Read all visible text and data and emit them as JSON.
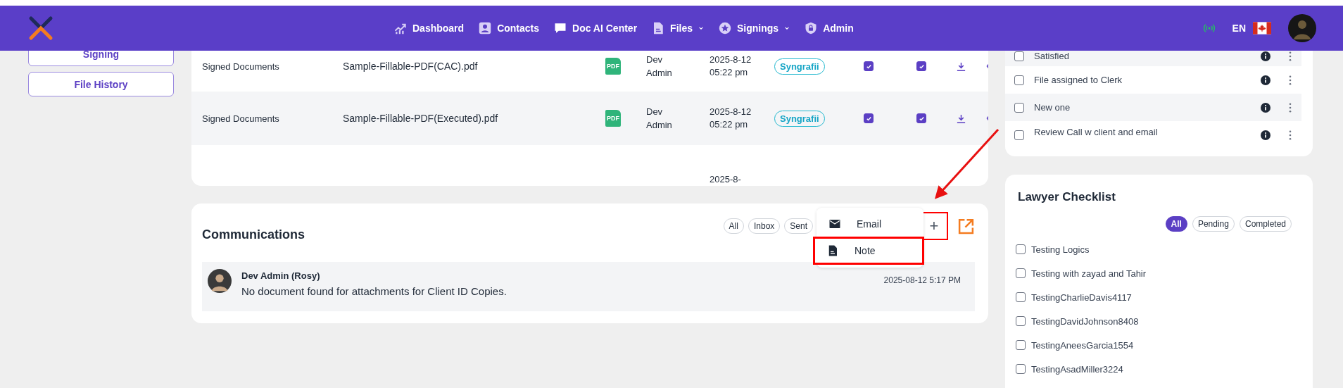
{
  "nav": {
    "menu": [
      {
        "label": "Dashboard",
        "dropdown": false
      },
      {
        "label": "Contacts",
        "dropdown": false
      },
      {
        "label": "Doc AI Center",
        "dropdown": false
      },
      {
        "label": "Files",
        "dropdown": true
      },
      {
        "label": "Signings",
        "dropdown": true
      },
      {
        "label": "Admin",
        "dropdown": false
      }
    ],
    "language": "EN"
  },
  "side_buttons": [
    "Signing",
    "File History"
  ],
  "documents": {
    "rows": [
      {
        "category": "Signed Documents",
        "file": "Sample-Fillable-PDF(CAC).pdf",
        "file_badge": "PDF",
        "uploaded_by": "Dev Admin",
        "date": "2025-8-12 05:22 pm",
        "platform": "Syngrafii",
        "check_1": true,
        "check_2": true
      },
      {
        "category": "Signed Documents",
        "file": "Sample-Fillable-PDF(Executed).pdf",
        "file_badge": "PDF",
        "uploaded_by": "Dev Admin",
        "date": "2025-8-12 05:22 pm",
        "platform": "Syngrafii",
        "check_1": true,
        "check_2": true
      },
      {
        "date": "2025-8-"
      }
    ]
  },
  "communications": {
    "title": "Communications",
    "filters": [
      {
        "label": "All",
        "selected": false
      },
      {
        "label": "Inbox",
        "selected": false
      },
      {
        "label": "Sent",
        "selected": false
      }
    ],
    "add_button": {
      "label": "+",
      "highlighted": true
    },
    "menu": [
      {
        "label": "Email",
        "highlighted": false
      },
      {
        "label": "Note",
        "highlighted": true
      }
    ],
    "callout_arrow": true,
    "messages": [
      {
        "author": "Dev Admin (Rosy)",
        "text": "No document found for attachments for Client ID Copies.",
        "time": "2025-08-12 5:17 PM"
      }
    ]
  },
  "tasks": {
    "items": [
      {
        "label": "Satisfied",
        "checked": false
      },
      {
        "label": "File assigned to Clerk",
        "checked": false
      },
      {
        "label": "New one",
        "checked": false
      },
      {
        "label": "Review Call w client and email",
        "checked": false
      }
    ]
  },
  "lawyer_checklist": {
    "title": "Lawyer Checklist",
    "filters": [
      {
        "label": "All",
        "selected": true
      },
      {
        "label": "Pending",
        "selected": false
      },
      {
        "label": "Completed",
        "selected": false
      }
    ],
    "items": [
      {
        "label": "Testing Logics",
        "checked": false
      },
      {
        "label": "Testing with zayad and Tahir",
        "checked": false
      },
      {
        "label": "TestingCharlieDavis4117",
        "checked": false
      },
      {
        "label": "TestingDavidJohnson8408",
        "checked": false
      },
      {
        "label": "TestingAneesGarcia1554",
        "checked": false
      },
      {
        "label": "TestingAsadMiller3224",
        "checked": false
      }
    ]
  }
}
